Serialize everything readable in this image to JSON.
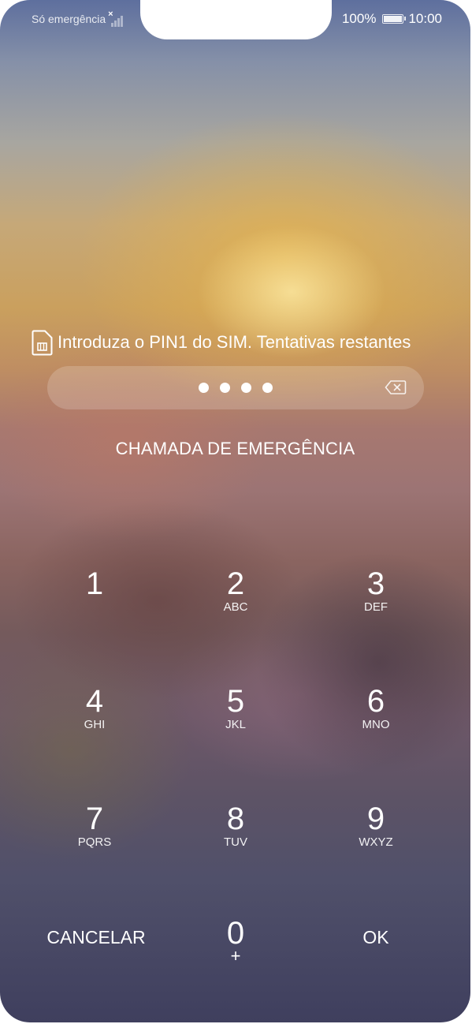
{
  "status_bar": {
    "carrier_text": "Só emergência",
    "battery": "100%",
    "time": "10:00"
  },
  "lock": {
    "prompt": "Introduza o PIN1 do SIM. Tentativas restantes",
    "pin_length": 4,
    "emergency_call": "CHAMADA DE EMERGÊNCIA"
  },
  "keypad": {
    "k1": {
      "num": "1",
      "letters": ""
    },
    "k2": {
      "num": "2",
      "letters": "ABC"
    },
    "k3": {
      "num": "3",
      "letters": "DEF"
    },
    "k4": {
      "num": "4",
      "letters": "GHI"
    },
    "k5": {
      "num": "5",
      "letters": "JKL"
    },
    "k6": {
      "num": "6",
      "letters": "MNO"
    },
    "k7": {
      "num": "7",
      "letters": "PQRS"
    },
    "k8": {
      "num": "8",
      "letters": "TUV"
    },
    "k9": {
      "num": "9",
      "letters": "WXYZ"
    },
    "k0": {
      "num": "0",
      "letters": "+"
    },
    "cancel": "CANCELAR",
    "ok": "OK"
  },
  "icons": {
    "signal": "signal-no-service-icon",
    "battery": "battery-full-icon",
    "sim": "sim-card-icon",
    "backspace": "backspace-icon"
  }
}
